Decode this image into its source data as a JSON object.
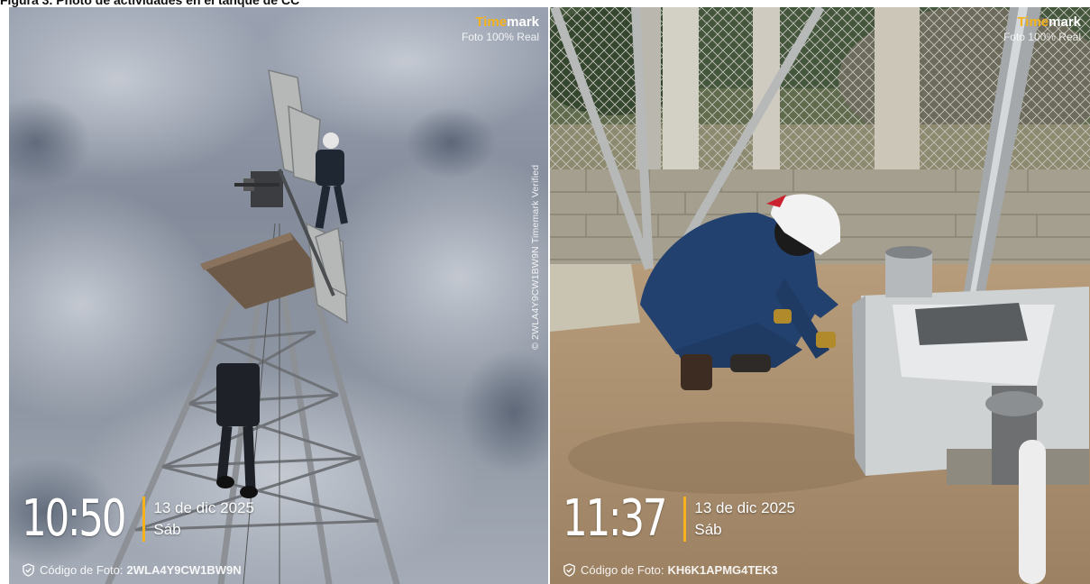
{
  "caption": "Figura 3. Photo de actividades en el tanque de CC",
  "photos": [
    {
      "brand_accent": "Time",
      "brand_rest": "mark",
      "brand_sub": "Foto 100% Real",
      "time": "10:50",
      "date": "13 de dic 2025",
      "day": "Sáb",
      "code_label": "Código de Foto:",
      "code_value": "2WLA4Y9CW1BW9N",
      "side_text": "© 2WLA4Y9CW1BW9N  Timemark Verified"
    },
    {
      "brand_accent": "Time",
      "brand_rest": "mark",
      "brand_sub": "Foto 100% Real",
      "time": "11:37",
      "date": "13 de dic 2025",
      "day": "Sáb",
      "code_label": "Código de Foto:",
      "code_value": "KH6K1APMG4TEK3"
    }
  ],
  "colors": {
    "accent": "#f6b21a",
    "overlay_text": "#ffffff"
  }
}
